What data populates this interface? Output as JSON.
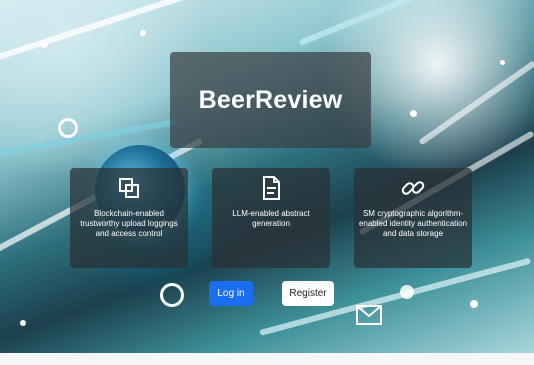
{
  "app": {
    "title": "BeerReview"
  },
  "features": [
    {
      "icon": "copy-squares-icon",
      "label": "Blockchain-enabled trustworthy upload loggings and access control"
    },
    {
      "icon": "document-icon",
      "label": "LLM-enabled abstract generation"
    },
    {
      "icon": "link-icon",
      "label": "SM cryptographic algorithm-enabled identity authentication and data storage"
    }
  ],
  "actions": {
    "login_label": "Log in",
    "register_label": "Register"
  },
  "colors": {
    "primary": "#1a6ff0",
    "card_bg": "#283034",
    "text_on_dark": "#ffffff"
  }
}
